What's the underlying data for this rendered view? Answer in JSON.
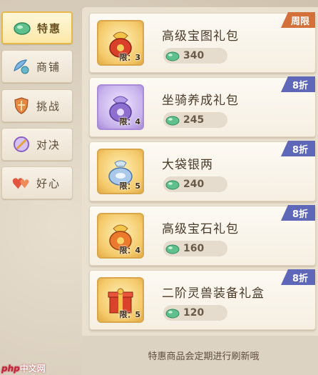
{
  "tabs": [
    {
      "label": "特惠",
      "icon": "jade-icon",
      "active": true
    },
    {
      "label": "商铺",
      "icon": "fan-icon",
      "active": false
    },
    {
      "label": "挑战",
      "icon": "shield-icon",
      "active": false
    },
    {
      "label": "对决",
      "icon": "sword-circle-icon",
      "active": false
    },
    {
      "label": "好心",
      "icon": "hearts-icon",
      "active": false
    }
  ],
  "items": [
    {
      "name": "高级宝图礼包",
      "price": "340",
      "limit": "限：3",
      "badge": "周限",
      "badge_color": "#d4713a",
      "icon": "red-pouch-icon"
    },
    {
      "name": "坐骑养成礼包",
      "price": "245",
      "limit": "限：4",
      "badge": "8折",
      "badge_color": "#5f67b8",
      "icon": "purple-pouch-icon"
    },
    {
      "name": "大袋银两",
      "price": "240",
      "limit": "限：5",
      "badge": "8折",
      "badge_color": "#5f67b8",
      "icon": "silver-bag-icon"
    },
    {
      "name": "高级宝石礼包",
      "price": "160",
      "limit": "限：4",
      "badge": "8折",
      "badge_color": "#5f67b8",
      "icon": "orange-pouch-icon"
    },
    {
      "name": "二阶灵兽装备礼盒",
      "price": "120",
      "limit": "限：5",
      "badge": "8折",
      "badge_color": "#5f67b8",
      "icon": "red-giftbox-icon"
    }
  ],
  "footer": {
    "notice": "特惠商品会定期进行刷新哦"
  },
  "watermark": {
    "php": "php",
    "site": "中文网"
  },
  "colors": {
    "accent_gold": "#e7b94a",
    "discount_badge": "#5f67b8",
    "limited_badge": "#d4713a"
  }
}
